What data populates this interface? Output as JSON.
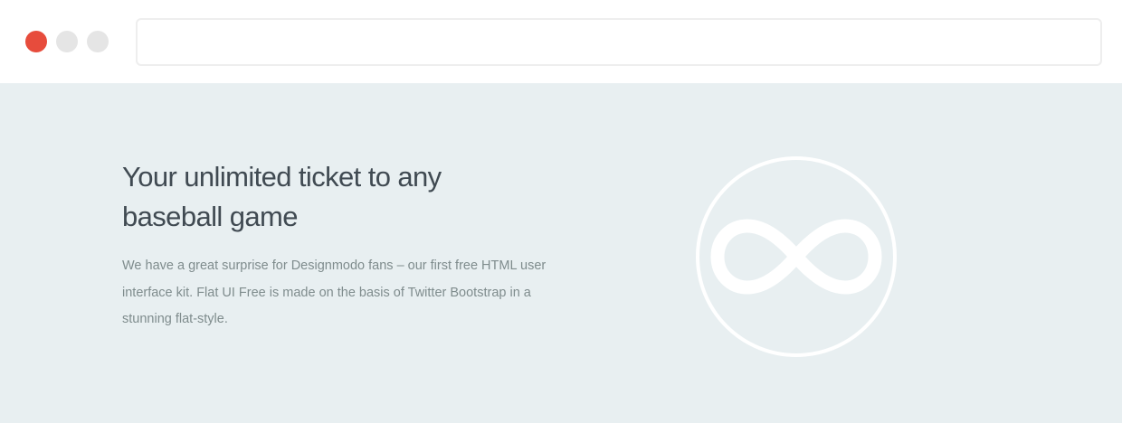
{
  "colors": {
    "window_close": "#e74c3c",
    "window_inactive": "#e5e5e5",
    "content_background": "#e8eff1",
    "headline": "#404a52",
    "body_text": "#7f8c8d",
    "icon": "#ffffff"
  },
  "window_controls": {
    "close": "close-dot",
    "minimize": "minimize-dot",
    "maximize": "maximize-dot"
  },
  "address_bar": {
    "value": ""
  },
  "hero": {
    "headline": "Your unlimited ticket to any baseball game",
    "description": "We have a great surprise for Designmodo fans – our first free HTML user interface kit. Flat UI Free is made on the basis of Twitter Bootstrap in a stunning flat-style.",
    "icon": "infinity-icon"
  }
}
